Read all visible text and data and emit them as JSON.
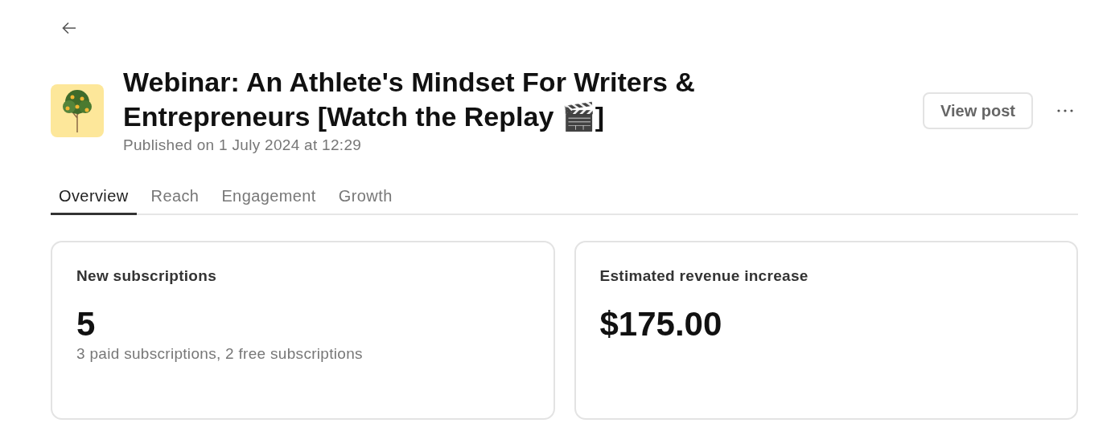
{
  "post": {
    "title": "Webinar: An Athlete's Mindset For Writers & Entrepreneurs [Watch the Replay 🎬]",
    "published": "Published on 1 July 2024 at 12:29"
  },
  "view_button": "View post",
  "tabs": [
    {
      "label": "Overview",
      "selected": true
    },
    {
      "label": "Reach",
      "selected": false
    },
    {
      "label": "Engagement",
      "selected": false
    },
    {
      "label": "Growth",
      "selected": false
    }
  ],
  "cards": [
    {
      "label": "New subscriptions",
      "value": "5",
      "detail": "3 paid subscriptions, 2 free subscriptions"
    },
    {
      "label": "Estimated revenue increase",
      "value": "$175.00"
    }
  ]
}
